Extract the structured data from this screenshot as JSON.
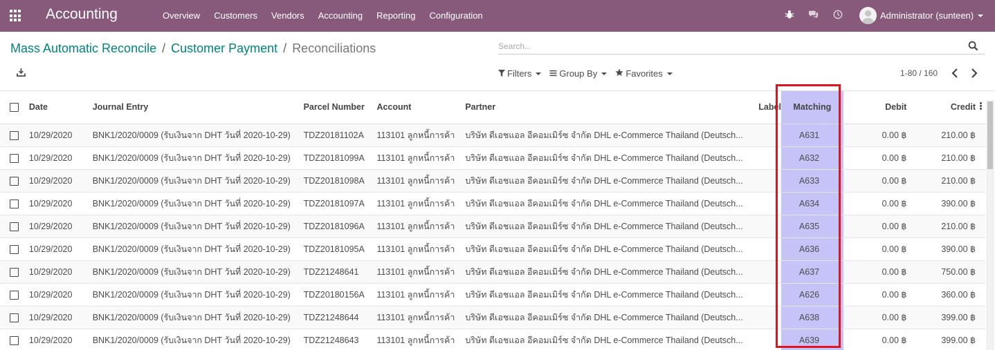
{
  "navbar": {
    "brand": "Accounting",
    "menu": [
      "Overview",
      "Customers",
      "Vendors",
      "Accounting",
      "Reporting",
      "Configuration"
    ],
    "user": "Administrator (sunteen)",
    "bg_color": "#875a7b"
  },
  "breadcrumb": {
    "items": [
      "Mass Automatic Reconcile",
      "Customer Payment"
    ],
    "separator": "/",
    "active": "Reconciliations"
  },
  "search": {
    "placeholder": "Search..."
  },
  "filters": {
    "filters": "Filters",
    "group_by": "Group By",
    "favorites": "Favorites"
  },
  "pager": {
    "range": "1-80 / 160"
  },
  "table": {
    "columns": {
      "date": "Date",
      "journal_entry": "Journal Entry",
      "parcel": "Parcel Number",
      "account": "Account",
      "partner": "Partner",
      "label": "Label",
      "matching": "Matching",
      "debit": "Debit",
      "credit": "Credit"
    },
    "rows": [
      {
        "date": "10/29/2020",
        "je": "BNK1/2020/0009 (รับเงินจาก DHT วันที่ 2020-10-29)",
        "parcel": "TDZ20181102A",
        "account": "113101 ลูกหนี้การค้า",
        "partner": "บริษัท ดีเอชแอล อีคอมเมิร์ซ จำกัด DHL e-Commerce Thailand (Deutsch...",
        "label": "",
        "matching": "A631",
        "debit": "0.00 ฿",
        "credit": "210.00 ฿"
      },
      {
        "date": "10/29/2020",
        "je": "BNK1/2020/0009 (รับเงินจาก DHT วันที่ 2020-10-29)",
        "parcel": "TDZ20181099A",
        "account": "113101 ลูกหนี้การค้า",
        "partner": "บริษัท ดีเอชแอล อีคอมเมิร์ซ จำกัด DHL e-Commerce Thailand (Deutsch...",
        "label": "",
        "matching": "A632",
        "debit": "0.00 ฿",
        "credit": "210.00 ฿"
      },
      {
        "date": "10/29/2020",
        "je": "BNK1/2020/0009 (รับเงินจาก DHT วันที่ 2020-10-29)",
        "parcel": "TDZ20181098A",
        "account": "113101 ลูกหนี้การค้า",
        "partner": "บริษัท ดีเอชแอล อีคอมเมิร์ซ จำกัด DHL e-Commerce Thailand (Deutsch...",
        "label": "",
        "matching": "A633",
        "debit": "0.00 ฿",
        "credit": "210.00 ฿"
      },
      {
        "date": "10/29/2020",
        "je": "BNK1/2020/0009 (รับเงินจาก DHT วันที่ 2020-10-29)",
        "parcel": "TDZ20181097A",
        "account": "113101 ลูกหนี้การค้า",
        "partner": "บริษัท ดีเอชแอล อีคอมเมิร์ซ จำกัด DHL e-Commerce Thailand (Deutsch...",
        "label": "",
        "matching": "A634",
        "debit": "0.00 ฿",
        "credit": "390.00 ฿"
      },
      {
        "date": "10/29/2020",
        "je": "BNK1/2020/0009 (รับเงินจาก DHT วันที่ 2020-10-29)",
        "parcel": "TDZ20181096A",
        "account": "113101 ลูกหนี้การค้า",
        "partner": "บริษัท ดีเอชแอล อีคอมเมิร์ซ จำกัด DHL e-Commerce Thailand (Deutsch...",
        "label": "",
        "matching": "A635",
        "debit": "0.00 ฿",
        "credit": "210.00 ฿"
      },
      {
        "date": "10/29/2020",
        "je": "BNK1/2020/0009 (รับเงินจาก DHT วันที่ 2020-10-29)",
        "parcel": "TDZ20181095A",
        "account": "113101 ลูกหนี้การค้า",
        "partner": "บริษัท ดีเอชแอล อีคอมเมิร์ซ จำกัด DHL e-Commerce Thailand (Deutsch...",
        "label": "",
        "matching": "A636",
        "debit": "0.00 ฿",
        "credit": "390.00 ฿"
      },
      {
        "date": "10/29/2020",
        "je": "BNK1/2020/0009 (รับเงินจาก DHT วันที่ 2020-10-29)",
        "parcel": "TDZ21248641",
        "account": "113101 ลูกหนี้การค้า",
        "partner": "บริษัท ดีเอชแอล อีคอมเมิร์ซ จำกัด DHL e-Commerce Thailand (Deutsch...",
        "label": "",
        "matching": "A637",
        "debit": "0.00 ฿",
        "credit": "750.00 ฿"
      },
      {
        "date": "10/29/2020",
        "je": "BNK1/2020/0009 (รับเงินจาก DHT วันที่ 2020-10-29)",
        "parcel": "TDZ20180156A",
        "account": "113101 ลูกหนี้การค้า",
        "partner": "บริษัท ดีเอชแอล อีคอมเมิร์ซ จำกัด DHL e-Commerce Thailand (Deutsch...",
        "label": "",
        "matching": "A626",
        "debit": "0.00 ฿",
        "credit": "360.00 ฿"
      },
      {
        "date": "10/29/2020",
        "je": "BNK1/2020/0009 (รับเงินจาก DHT วันที่ 2020-10-29)",
        "parcel": "TDZ21248644",
        "account": "113101 ลูกหนี้การค้า",
        "partner": "บริษัท ดีเอชแอล อีคอมเมิร์ซ จำกัด DHL e-Commerce Thailand (Deutsch...",
        "label": "",
        "matching": "A638",
        "debit": "0.00 ฿",
        "credit": "399.00 ฿"
      },
      {
        "date": "10/29/2020",
        "je": "BNK1/2020/0009 (รับเงินจาก DHT วันที่ 2020-10-29)",
        "parcel": "TDZ21248643",
        "account": "113101 ลูกหนี้การค้า",
        "partner": "บริษัท ดีเอชแอล อีคอมเมิร์ซ จำกัด DHL e-Commerce Thailand (Deutsch...",
        "label": "",
        "matching": "A639",
        "debit": "0.00 ฿",
        "credit": "399.00 ฿"
      }
    ]
  },
  "colors": {
    "link": "#00827f",
    "matching_highlight": "#c5c3f7",
    "annotation_box": "#e0141e"
  },
  "icons": [
    "apps-icon",
    "bug-icon",
    "chat-icon",
    "clock-icon",
    "search-icon",
    "download-icon",
    "filter-icon",
    "list-icon",
    "star-icon",
    "chevron-left-icon",
    "chevron-right-icon",
    "column-options-icon"
  ]
}
